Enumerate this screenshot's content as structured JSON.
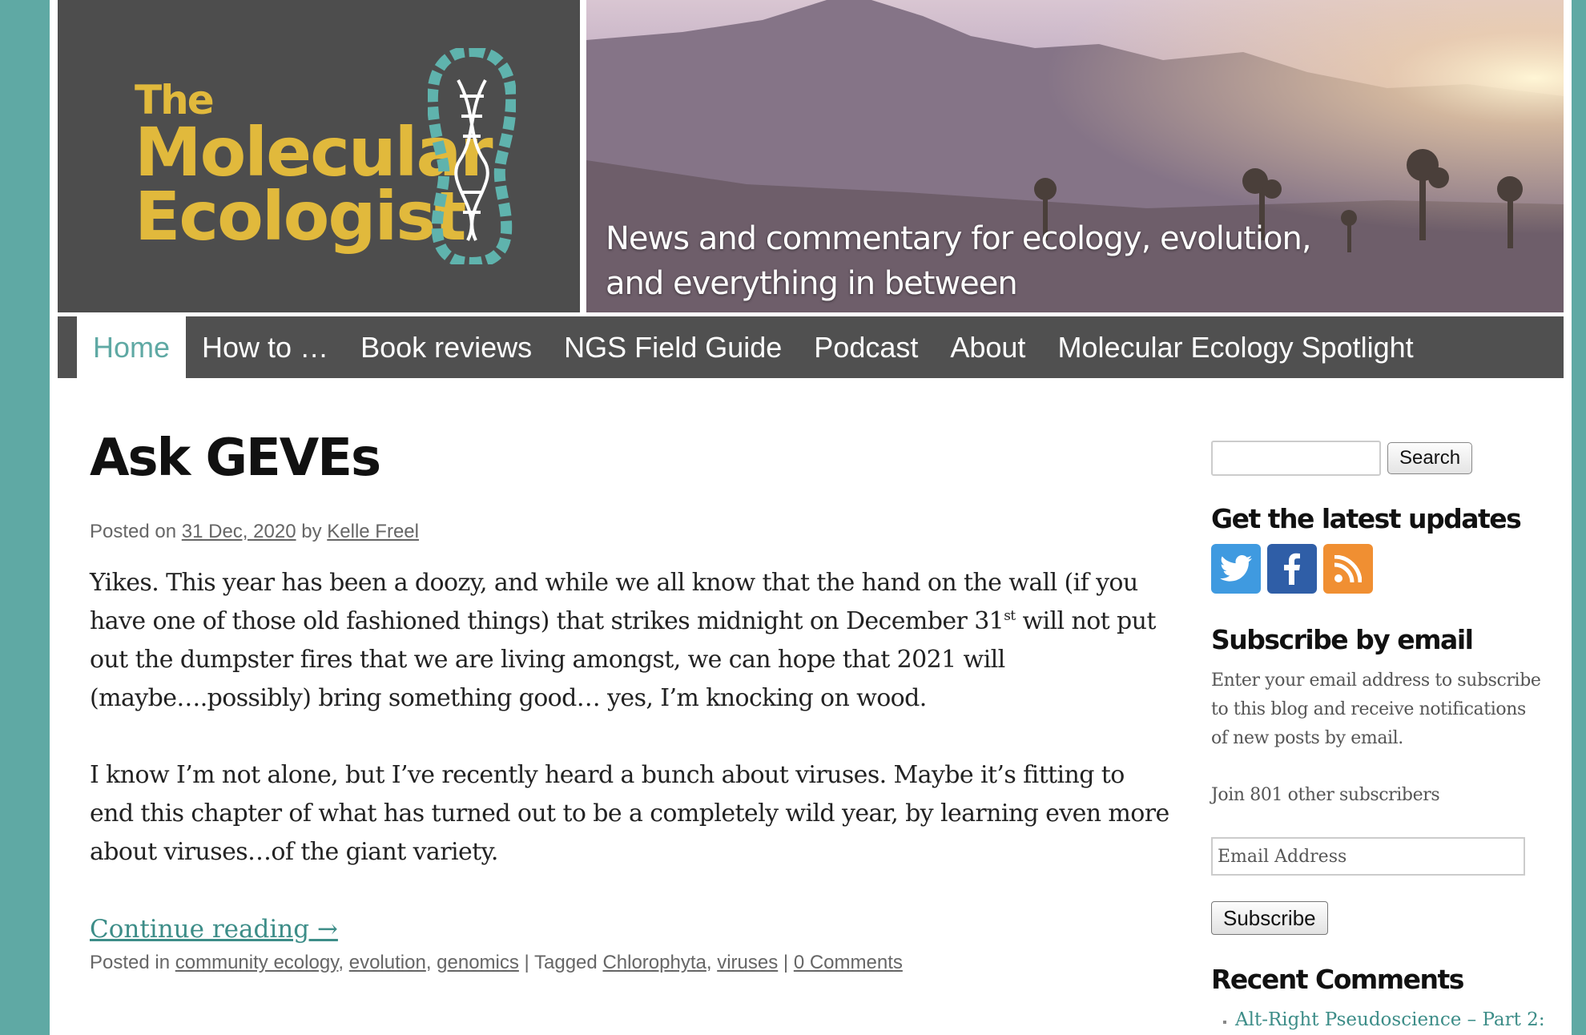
{
  "brand": {
    "logo_the": "The",
    "logo_molecular": "Molecular",
    "logo_ecologist": "Ecologist",
    "tagline_line1": "News and commentary for ecology, evolution,",
    "tagline_line2": "and everything in between",
    "logo_color": "#e1b93c",
    "accent_color": "#5fa9a4"
  },
  "nav": {
    "items": [
      {
        "label": "Home"
      },
      {
        "label": "How to …"
      },
      {
        "label": "Book reviews"
      },
      {
        "label": "NGS Field Guide"
      },
      {
        "label": "Podcast"
      },
      {
        "label": "About"
      },
      {
        "label": "Molecular Ecology Spotlight"
      }
    ],
    "active": "Home"
  },
  "post": {
    "title": "Ask GEVEs",
    "posted_on_label": "Posted on",
    "date": "31 Dec, 2020",
    "by_label": "by",
    "author": "Kelle Freel",
    "p1_a": "Yikes. This year has been a doozy, and while we all know that the hand on the wall (if you have one of those old fashioned things) that strikes midnight on December 31",
    "p1_sup": "st",
    "p1_b": " will not put out the dumpster fires that we are living amongst, we can hope that 2021 will (maybe….possibly) bring something good… yes, I’m knocking on wood.",
    "p2": "I know I’m not alone, but I’ve recently heard a bunch about viruses. Maybe it’s fitting to end this chapter of what has turned out to be a completely wild year, by learning even more about viruses…of the giant variety.",
    "continue_label": "Continue reading →",
    "posted_in_label": "Posted in",
    "categories": [
      "community ecology",
      "evolution",
      "genomics"
    ],
    "tagged_label": "Tagged",
    "tags": [
      "Chlorophyta",
      "viruses"
    ],
    "comments": "0 Comments"
  },
  "sidebar": {
    "search_button": "Search",
    "updates_title": "Get the latest updates",
    "social": [
      {
        "icon": "twitter-icon",
        "color": "#3f9ae0"
      },
      {
        "icon": "facebook-icon",
        "color": "#2f5ea7"
      },
      {
        "icon": "rss-icon",
        "color": "#f08f32"
      }
    ],
    "subscribe_title": "Subscribe by email",
    "subscribe_desc": "Enter your email address to subscribe to this blog and receive notifications of new posts by email.",
    "join_text": "Join 801 other subscribers",
    "email_placeholder": "Email Address",
    "subscribe_button": "Subscribe",
    "recent_title": "Recent Comments",
    "recent_items": [
      "Alt-Right Pseudoscience – Part 2:"
    ]
  }
}
